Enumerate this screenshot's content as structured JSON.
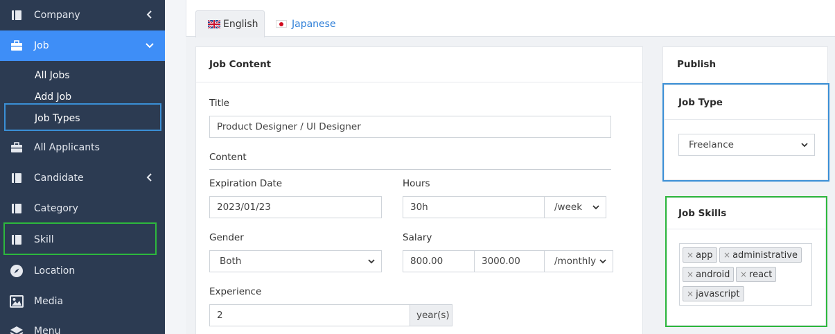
{
  "sidebar": {
    "items": [
      {
        "label": "Company",
        "icon": "book-icon",
        "chevron": "left"
      },
      {
        "label": "Job",
        "icon": "briefcase-icon",
        "chevron": "down",
        "active": true
      },
      {
        "label": "All Applicants",
        "icon": "briefcase-icon"
      },
      {
        "label": "Candidate",
        "icon": "book-icon",
        "chevron": "left"
      },
      {
        "label": "Category",
        "icon": "book-icon"
      },
      {
        "label": "Skill",
        "icon": "book-icon"
      },
      {
        "label": "Location",
        "icon": "compass-icon"
      },
      {
        "label": "Media",
        "icon": "image-icon"
      },
      {
        "label": "Menu",
        "icon": "layers-icon"
      }
    ],
    "job_submenu": [
      "All Jobs",
      "Add Job",
      "Job Types"
    ]
  },
  "tabs": [
    {
      "label": "English",
      "icon": "uk-flag-icon",
      "active": true
    },
    {
      "label": "Japanese",
      "icon": "japan-flag-icon"
    }
  ],
  "job_content": {
    "heading": "Job Content",
    "title_label": "Title",
    "title_value": "Product Designer / UI Designer",
    "content_label": "Content",
    "expiration_label": "Expiration Date",
    "expiration_value": "2023/01/23",
    "hours_label": "Hours",
    "hours_value": "30h",
    "hours_unit": "/week",
    "gender_label": "Gender",
    "gender_value": "Both",
    "salary_label": "Salary",
    "salary_min": "800.00",
    "salary_max": "3000.00",
    "salary_unit": "/monthly",
    "experience_label": "Experience",
    "experience_value": "2",
    "experience_unit": "year(s)"
  },
  "publish": {
    "heading": "Publish"
  },
  "job_type": {
    "heading": "Job Type",
    "value": "Freelance"
  },
  "job_skills": {
    "heading": "Job Skills",
    "tags": [
      "app",
      "administrative",
      "android",
      "react",
      "javascript"
    ]
  },
  "colors": {
    "sidebar_bg": "#2c3b52",
    "active_bg": "#3e8ef7",
    "highlight_blue": "#3a8fd6",
    "highlight_green": "#2db83d",
    "link": "#2e7fd8"
  }
}
